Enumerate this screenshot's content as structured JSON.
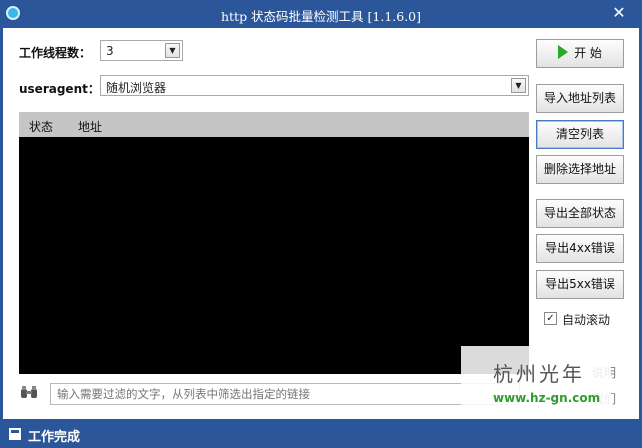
{
  "window": {
    "title": "http 状态码批量检测工具 [1.1.6.0]",
    "close_glyph": "✕"
  },
  "form": {
    "threads_label": "工作线程数：",
    "threads_value": "3",
    "useragent_label": "useragent：",
    "useragent_value": "随机浏览器"
  },
  "list": {
    "columns": [
      "状态",
      "地址"
    ],
    "rows": []
  },
  "buttons": {
    "start": "开 始",
    "import": "导入地址列表",
    "clear": "清空列表",
    "delete_selected": "删除选择地址",
    "export_all": "导出全部状态",
    "export_4xx": "导出4xx错误",
    "export_5xx": "导出5xx错误"
  },
  "auto_scroll": {
    "label": "自动滚动",
    "checked": true,
    "check_glyph": "✓"
  },
  "filter": {
    "placeholder": "输入需要过滤的文字，从列表中筛选出指定的链接"
  },
  "links": {
    "help": "说明",
    "about": "我们"
  },
  "watermark": {
    "title": "杭州光年",
    "url": "www.hz-gn.com"
  },
  "status": {
    "text": "工作完成"
  },
  "icons": {
    "arrow_down": "▼"
  },
  "colors": {
    "titlebar": "#2b579a",
    "start_icon": "#2aa82a",
    "list_bg": "#000000"
  }
}
